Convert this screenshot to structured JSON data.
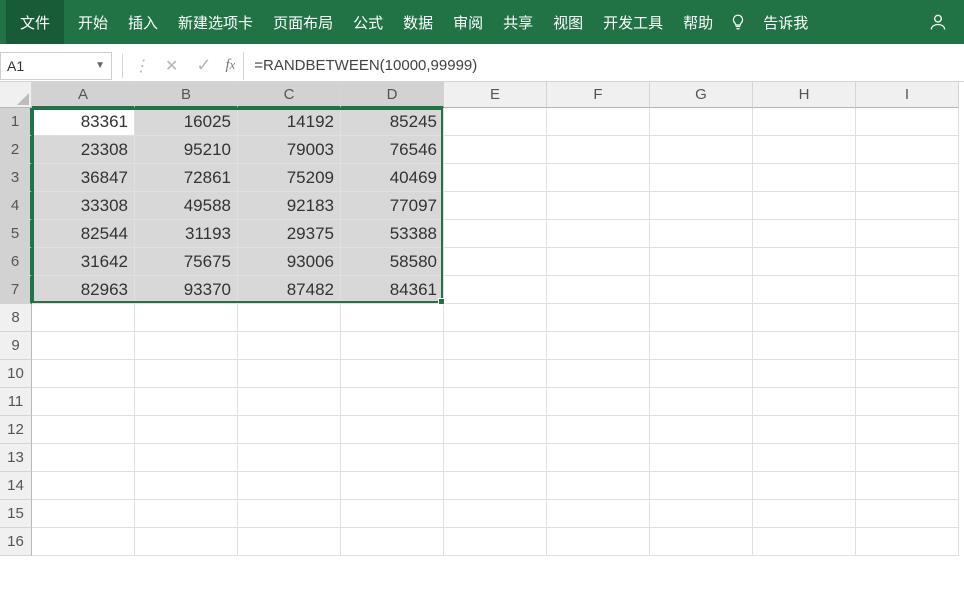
{
  "ribbon": {
    "file": "文件",
    "tabs": [
      "开始",
      "插入",
      "新建选项卡",
      "页面布局",
      "公式",
      "数据",
      "审阅",
      "共享",
      "视图",
      "开发工具",
      "帮助"
    ],
    "tellme": "告诉我"
  },
  "formula_bar": {
    "name_box": "A1",
    "formula": "=RANDBETWEEN(10000,99999)"
  },
  "grid": {
    "columns": [
      "A",
      "B",
      "C",
      "D",
      "E",
      "F",
      "G",
      "H",
      "I"
    ],
    "rows": [
      "1",
      "2",
      "3",
      "4",
      "5",
      "6",
      "7",
      "8",
      "9",
      "10",
      "11",
      "12",
      "13",
      "14",
      "15",
      "16"
    ],
    "selected_cols": [
      "A",
      "B",
      "C",
      "D"
    ],
    "selected_rows": [
      "1",
      "2",
      "3",
      "4",
      "5",
      "6",
      "7"
    ],
    "active_cell": {
      "row": 0,
      "col": 0
    },
    "data": [
      [
        "83361",
        "16025",
        "14192",
        "85245",
        "",
        "",
        "",
        "",
        ""
      ],
      [
        "23308",
        "95210",
        "79003",
        "76546",
        "",
        "",
        "",
        "",
        ""
      ],
      [
        "36847",
        "72861",
        "75209",
        "40469",
        "",
        "",
        "",
        "",
        ""
      ],
      [
        "33308",
        "49588",
        "92183",
        "77097",
        "",
        "",
        "",
        "",
        ""
      ],
      [
        "82544",
        "31193",
        "29375",
        "53388",
        "",
        "",
        "",
        "",
        ""
      ],
      [
        "31642",
        "75675",
        "93006",
        "58580",
        "",
        "",
        "",
        "",
        ""
      ],
      [
        "82963",
        "93370",
        "87482",
        "84361",
        "",
        "",
        "",
        "",
        ""
      ],
      [
        "",
        "",
        "",
        "",
        "",
        "",
        "",
        "",
        ""
      ],
      [
        "",
        "",
        "",
        "",
        "",
        "",
        "",
        "",
        ""
      ],
      [
        "",
        "",
        "",
        "",
        "",
        "",
        "",
        "",
        ""
      ],
      [
        "",
        "",
        "",
        "",
        "",
        "",
        "",
        "",
        ""
      ],
      [
        "",
        "",
        "",
        "",
        "",
        "",
        "",
        "",
        ""
      ],
      [
        "",
        "",
        "",
        "",
        "",
        "",
        "",
        "",
        ""
      ],
      [
        "",
        "",
        "",
        "",
        "",
        "",
        "",
        "",
        ""
      ],
      [
        "",
        "",
        "",
        "",
        "",
        "",
        "",
        "",
        ""
      ],
      [
        "",
        "",
        "",
        "",
        "",
        "",
        "",
        "",
        ""
      ]
    ]
  }
}
